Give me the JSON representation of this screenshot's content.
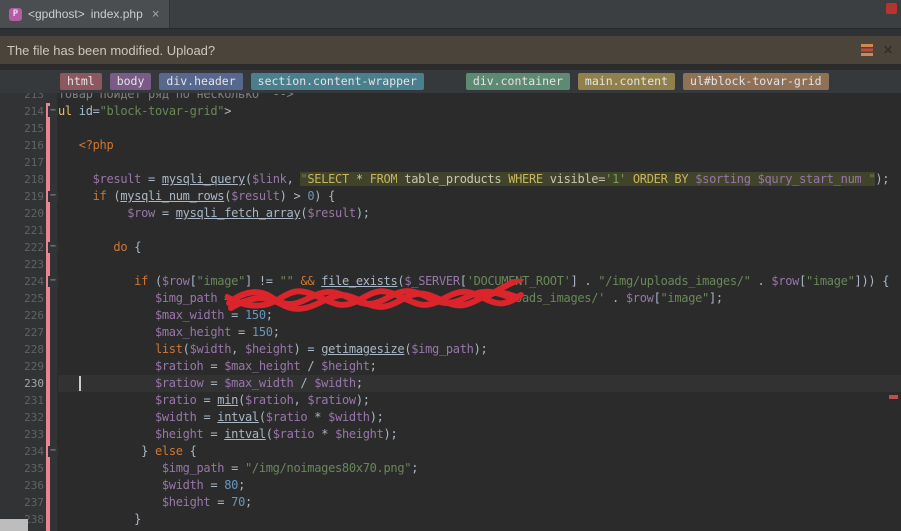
{
  "tab": {
    "project": "<gpdhost>",
    "file": "index.php",
    "close_label": "×",
    "icon": "php-file-icon"
  },
  "notification": {
    "message": "The file has been modified. Upload?",
    "close_label": "✕",
    "upload_icon": "upload-sync-icon"
  },
  "breadcrumbs": [
    {
      "label": "html",
      "bg": "#8d5760"
    },
    {
      "label": "body",
      "bg": "#7a5a87"
    },
    {
      "label": "div.header",
      "bg": "#57688f"
    },
    {
      "label": "section.content-wrapper",
      "bg": "#4a7f8d"
    },
    {
      "label": "div.container",
      "bg": "#5d8a72",
      "gap": 34
    },
    {
      "label": "main.content",
      "bg": "#90804b"
    },
    {
      "label": "ul#block-tovar-grid",
      "bg": "#8f7158"
    }
  ],
  "colors": {
    "editor_bg": "#2b2b2b",
    "gutter_bg": "#313335",
    "vcs_changed_stripe": "#ee8394",
    "current_line_bg": "#323232",
    "sql_injection_bg": "#41432b",
    "scribble_red": "#e3242b",
    "error_indicator": "#b5342e",
    "error_stripe_mark": "#bf4f4a"
  },
  "editor": {
    "current_line": 230,
    "caret_col": 3,
    "fold_lines": [
      214,
      219,
      222,
      224,
      234
    ],
    "lines": [
      {
        "num": 213,
        "ind": 0,
        "segs": [
          [
            "c",
            "товар пойдет ряд по несколько  -->"
          ]
        ]
      },
      {
        "num": 214,
        "ind": 0,
        "segs": [
          [
            "t",
            "ul"
          ],
          [
            "p",
            " "
          ],
          [
            "a",
            "id"
          ],
          [
            "p",
            "="
          ],
          [
            "s",
            "\"block-tovar-grid\""
          ],
          [
            "p",
            ">"
          ]
        ]
      },
      {
        "num": 215,
        "ind": 0,
        "segs": []
      },
      {
        "num": 216,
        "ind": 3,
        "segs": [
          [
            "k",
            "<?php"
          ]
        ]
      },
      {
        "num": 217,
        "ind": 0,
        "segs": []
      },
      {
        "num": 218,
        "ind": 5,
        "segs": [
          [
            "v",
            "$result"
          ],
          [
            "p",
            " = "
          ],
          [
            "f",
            "mysqli_query"
          ],
          [
            "p",
            "("
          ],
          [
            "v",
            "$link"
          ],
          [
            "p",
            ", "
          ],
          [
            "sq",
            "\""
          ],
          [
            "skw",
            "SELECT"
          ],
          [
            "sid",
            " * "
          ],
          [
            "skw",
            "FROM"
          ],
          [
            "sid",
            " table_products "
          ],
          [
            "skw",
            "WHERE"
          ],
          [
            "sid",
            " visible="
          ],
          [
            "sst",
            "'1'"
          ],
          [
            "sid",
            " "
          ],
          [
            "skw",
            "ORDER BY"
          ],
          [
            "sid",
            " "
          ],
          [
            "svr",
            "$sorting"
          ],
          [
            "sid",
            " "
          ],
          [
            "svr",
            "$qury_start_num"
          ],
          [
            "sid",
            " "
          ],
          [
            "sq",
            "\""
          ],
          [
            "p",
            ");"
          ]
        ]
      },
      {
        "num": 219,
        "ind": 5,
        "segs": [
          [
            "k",
            "if"
          ],
          [
            "p",
            " ("
          ],
          [
            "f",
            "mysqli_num_rows"
          ],
          [
            "p",
            "("
          ],
          [
            "v",
            "$result"
          ],
          [
            "p",
            ") > "
          ],
          [
            "n",
            "0"
          ],
          [
            "p",
            ") {"
          ]
        ]
      },
      {
        "num": 220,
        "ind": 10,
        "segs": [
          [
            "v",
            "$row"
          ],
          [
            "p",
            " = "
          ],
          [
            "f",
            "mysqli_fetch_array"
          ],
          [
            "p",
            "("
          ],
          [
            "v",
            "$result"
          ],
          [
            "p",
            ");"
          ]
        ]
      },
      {
        "num": 221,
        "ind": 0,
        "segs": []
      },
      {
        "num": 222,
        "ind": 8,
        "segs": [
          [
            "k",
            "do"
          ],
          [
            "p",
            " {"
          ]
        ]
      },
      {
        "num": 223,
        "ind": 0,
        "segs": []
      },
      {
        "num": 224,
        "ind": 11,
        "segs": [
          [
            "k",
            "if"
          ],
          [
            "p",
            " ("
          ],
          [
            "v",
            "$row"
          ],
          [
            "p",
            "["
          ],
          [
            "s",
            "\"image\""
          ],
          [
            "p",
            "] != "
          ],
          [
            "s",
            "\"\""
          ],
          [
            "p",
            " "
          ],
          [
            "k",
            "&&"
          ],
          [
            "p",
            " "
          ],
          [
            "f",
            "file_exists"
          ],
          [
            "p",
            "("
          ],
          [
            "v",
            "$_SERVER"
          ],
          [
            "p",
            "["
          ],
          [
            "s",
            "'DOCUMENT_ROOT'"
          ],
          [
            "p",
            "] . "
          ],
          [
            "s",
            "\"/img/uploads_images/\""
          ],
          [
            "p",
            " . "
          ],
          [
            "v",
            "$row"
          ],
          [
            "p",
            "["
          ],
          [
            "s",
            "\"image\""
          ],
          [
            "p",
            "])) {"
          ]
        ]
      },
      {
        "num": 225,
        "ind": 14,
        "segs": [
          [
            "v",
            "$img_path"
          ],
          [
            "p",
            " = "
          ],
          [
            "s",
            "'                                      "
          ],
          [
            "s",
            "loads_images/'"
          ],
          [
            "p",
            " . "
          ],
          [
            "v",
            "$row"
          ],
          [
            "p",
            "["
          ],
          [
            "s",
            "\"image\""
          ],
          [
            "p",
            "];"
          ]
        ]
      },
      {
        "num": 226,
        "ind": 14,
        "segs": [
          [
            "v",
            "$max_width"
          ],
          [
            "p",
            " = "
          ],
          [
            "n",
            "150"
          ],
          [
            "p",
            ";"
          ]
        ]
      },
      {
        "num": 227,
        "ind": 14,
        "segs": [
          [
            "v",
            "$max_height"
          ],
          [
            "p",
            " = "
          ],
          [
            "n",
            "150"
          ],
          [
            "p",
            ";"
          ]
        ]
      },
      {
        "num": 228,
        "ind": 14,
        "segs": [
          [
            "k",
            "list"
          ],
          [
            "p",
            "("
          ],
          [
            "v",
            "$width"
          ],
          [
            "p",
            ", "
          ],
          [
            "v",
            "$height"
          ],
          [
            "p",
            ") = "
          ],
          [
            "f",
            "getimagesize"
          ],
          [
            "p",
            "("
          ],
          [
            "v",
            "$img_path"
          ],
          [
            "p",
            ");"
          ]
        ]
      },
      {
        "num": 229,
        "ind": 14,
        "segs": [
          [
            "v",
            "$ratioh"
          ],
          [
            "p",
            " = "
          ],
          [
            "v",
            "$max_height"
          ],
          [
            "p",
            " / "
          ],
          [
            "v",
            "$height"
          ],
          [
            "p",
            ";"
          ]
        ]
      },
      {
        "num": 230,
        "ind": 14,
        "segs": [
          [
            "v",
            "$ratiow"
          ],
          [
            "p",
            " = "
          ],
          [
            "v",
            "$max_width"
          ],
          [
            "p",
            " / "
          ],
          [
            "v",
            "$width"
          ],
          [
            "p",
            ";"
          ]
        ]
      },
      {
        "num": 231,
        "ind": 14,
        "segs": [
          [
            "v",
            "$ratio"
          ],
          [
            "p",
            " = "
          ],
          [
            "f",
            "min"
          ],
          [
            "p",
            "("
          ],
          [
            "v",
            "$ratioh"
          ],
          [
            "p",
            ", "
          ],
          [
            "v",
            "$ratiow"
          ],
          [
            "p",
            ");"
          ]
        ]
      },
      {
        "num": 232,
        "ind": 14,
        "segs": [
          [
            "v",
            "$width"
          ],
          [
            "p",
            " = "
          ],
          [
            "f",
            "intval"
          ],
          [
            "p",
            "("
          ],
          [
            "v",
            "$ratio"
          ],
          [
            "p",
            " * "
          ],
          [
            "v",
            "$width"
          ],
          [
            "p",
            ");"
          ]
        ]
      },
      {
        "num": 233,
        "ind": 14,
        "segs": [
          [
            "v",
            "$height"
          ],
          [
            "p",
            " = "
          ],
          [
            "f",
            "intval"
          ],
          [
            "p",
            "("
          ],
          [
            "v",
            "$ratio"
          ],
          [
            "p",
            " * "
          ],
          [
            "v",
            "$height"
          ],
          [
            "p",
            ");"
          ]
        ]
      },
      {
        "num": 234,
        "ind": 12,
        "segs": [
          [
            "p",
            "} "
          ],
          [
            "k",
            "else"
          ],
          [
            "p",
            " {"
          ]
        ]
      },
      {
        "num": 235,
        "ind": 15,
        "segs": [
          [
            "v",
            "$img_path"
          ],
          [
            "p",
            " = "
          ],
          [
            "s",
            "\"/img/noimages80x70.png\""
          ],
          [
            "p",
            ";"
          ]
        ]
      },
      {
        "num": 236,
        "ind": 15,
        "segs": [
          [
            "v",
            "$width"
          ],
          [
            "p",
            " = "
          ],
          [
            "n",
            "80"
          ],
          [
            "p",
            ";"
          ]
        ]
      },
      {
        "num": 237,
        "ind": 15,
        "segs": [
          [
            "v",
            "$height"
          ],
          [
            "p",
            " = "
          ],
          [
            "n",
            "70"
          ],
          [
            "p",
            ";"
          ]
        ]
      },
      {
        "num": 238,
        "ind": 11,
        "segs": [
          [
            "p",
            "}"
          ]
        ]
      }
    ]
  }
}
